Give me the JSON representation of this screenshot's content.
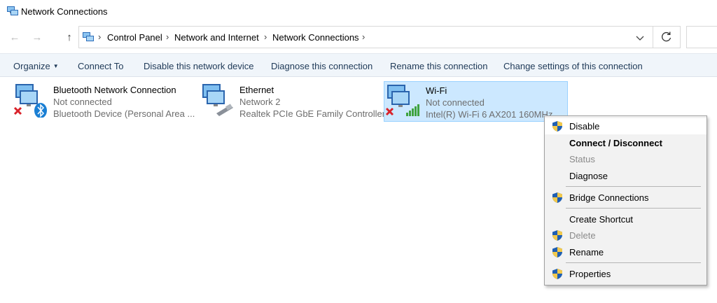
{
  "window": {
    "title": "Network Connections"
  },
  "nav": {
    "back_icon": "arrow-left-icon",
    "forward_icon": "arrow-right-icon",
    "up_icon": "arrow-up-icon",
    "breadcrumb": [
      "Control Panel",
      "Network and Internet",
      "Network Connections"
    ],
    "refresh_icon": "refresh-icon"
  },
  "commands": {
    "organize": "Organize",
    "connect_to": "Connect To",
    "disable": "Disable this network device",
    "diagnose": "Diagnose this connection",
    "rename": "Rename this connection",
    "change_settings": "Change settings of this connection"
  },
  "connections": [
    {
      "name": "Bluetooth Network Connection",
      "status": "Not connected",
      "device": "Bluetooth Device (Personal Area ...",
      "icon": "bluetooth-network-icon"
    },
    {
      "name": "Ethernet",
      "status": "Network 2",
      "device": "Realtek PCIe GbE Family Controller",
      "icon": "ethernet-icon"
    },
    {
      "name": "Wi-Fi",
      "status": "Not connected",
      "device": "Intel(R) Wi-Fi 6 AX201 160MHz",
      "icon": "wifi-icon",
      "selected": true
    }
  ],
  "context_menu": {
    "items": [
      {
        "label": "Disable",
        "shield": true
      },
      {
        "label": "Connect / Disconnect",
        "bold": true
      },
      {
        "label": "Status",
        "disabled": true
      },
      {
        "label": "Diagnose"
      },
      {
        "label": "Bridge Connections",
        "shield": true
      },
      {
        "label": "Create Shortcut"
      },
      {
        "label": "Delete",
        "shield": true,
        "disabled": true
      },
      {
        "label": "Rename",
        "shield": true
      },
      {
        "label": "Properties",
        "shield": true
      }
    ]
  },
  "colors": {
    "selection_bg": "#cce8ff",
    "selection_border": "#99d1ff",
    "command_bar_bg": "#f0f5fa",
    "menu_bg": "#f2f2f2"
  }
}
